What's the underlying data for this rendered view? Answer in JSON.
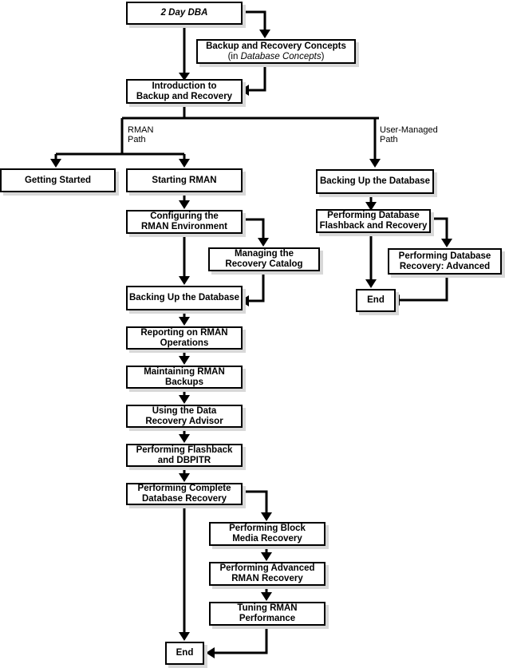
{
  "nodes": {
    "two_day_dba": "2 Day DBA",
    "concepts": {
      "title": "Backup and Recovery Concepts",
      "sub_prefix": "(in ",
      "sub_italic": "Database Concepts",
      "sub_suffix": ")"
    },
    "intro": [
      "Introduction to",
      "Backup and Recovery"
    ],
    "getting_started": "Getting Started",
    "starting_rman": "Starting RMAN",
    "configuring": [
      "Configuring the",
      "RMAN Environment"
    ],
    "catalog": [
      "Managing the",
      "Recovery Catalog"
    ],
    "backing_up_rman": "Backing Up the Database",
    "reporting": [
      "Reporting on RMAN",
      "Operations"
    ],
    "maintaining": [
      "Maintaining RMAN",
      "Backups"
    ],
    "advisor": [
      "Using the Data",
      "Recovery Advisor"
    ],
    "flashback_dbpitr": [
      "Performing Flashback",
      "and DBPITR"
    ],
    "complete_recovery": [
      "Performing Complete",
      "Database Recovery"
    ],
    "block_media": [
      "Performing Block",
      "Media Recovery"
    ],
    "advanced_rman": [
      "Performing Advanced",
      "RMAN Recovery"
    ],
    "tuning": [
      "Tuning RMAN",
      "Performance"
    ],
    "end_rman": "End",
    "backing_up_user": "Backing Up the Database",
    "db_flashback_recovery": [
      "Performing Database",
      "Flashback and Recovery"
    ],
    "db_recovery_advanced": [
      "Performing Database",
      "Recovery: Advanced"
    ],
    "end_user": "End"
  },
  "labels": {
    "rman_path": [
      "RMAN",
      "Path"
    ],
    "user_path": [
      "User-Managed",
      "Path"
    ]
  }
}
